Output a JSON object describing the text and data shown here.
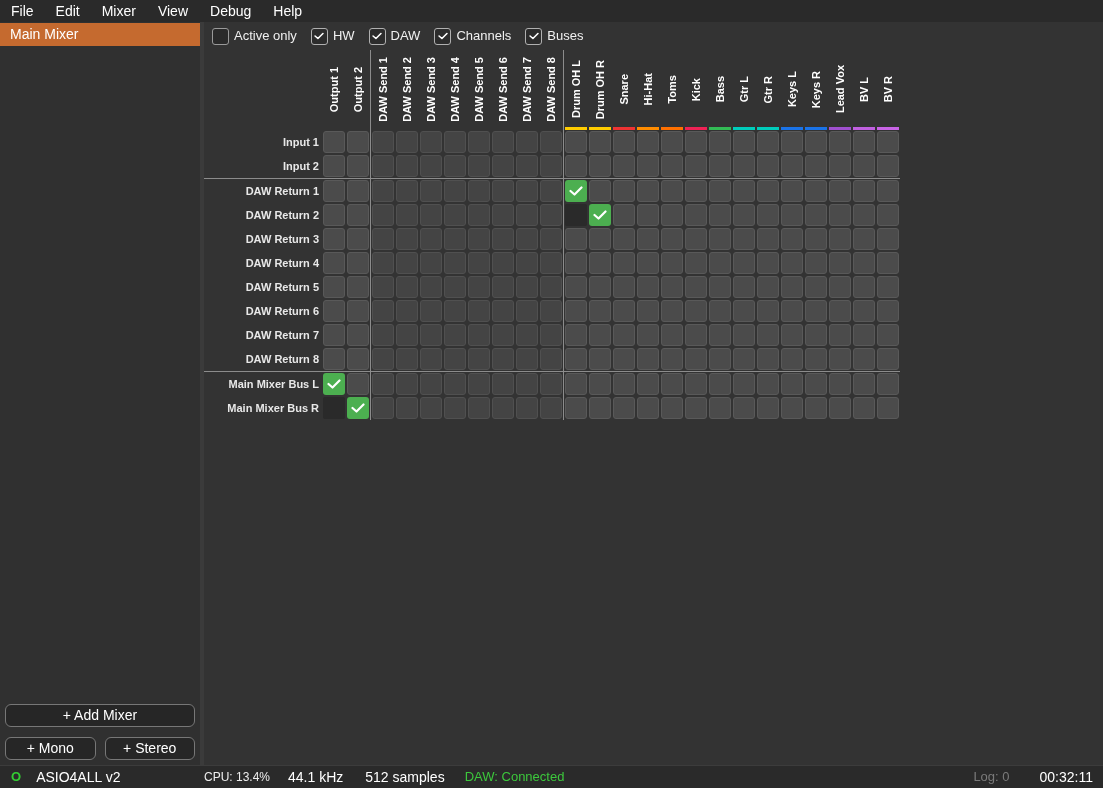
{
  "menu": [
    "File",
    "Edit",
    "Mixer",
    "View",
    "Debug",
    "Help"
  ],
  "sidebar": {
    "mixers": [
      {
        "label": "Main Mixer",
        "selected": true
      }
    ],
    "add_mixer_button": "+ Add Mixer",
    "add_channel_buttons": [
      "+ Mono",
      "+ Stereo"
    ]
  },
  "filters": [
    {
      "label": "Active only",
      "checked": false
    },
    {
      "label": "HW",
      "checked": true
    },
    {
      "label": "DAW",
      "checked": true
    },
    {
      "label": "Channels",
      "checked": true
    },
    {
      "label": "Buses",
      "checked": true
    }
  ],
  "matrix": {
    "column_groups": [
      {
        "kind": "hardware",
        "columns": [
          {
            "label": "Output 1"
          },
          {
            "label": "Output 2"
          }
        ]
      },
      {
        "kind": "daw",
        "columns": [
          {
            "label": "DAW Send 1"
          },
          {
            "label": "DAW Send 2"
          },
          {
            "label": "DAW Send 3"
          },
          {
            "label": "DAW Send 4"
          },
          {
            "label": "DAW Send 5"
          },
          {
            "label": "DAW Send 6"
          },
          {
            "label": "DAW Send 7"
          },
          {
            "label": "DAW Send 8"
          }
        ]
      },
      {
        "kind": "channel",
        "columns": [
          {
            "label": "Drum OH L",
            "color": "#ffcc00"
          },
          {
            "label": "Drum OH R",
            "color": "#ffcc00"
          },
          {
            "label": "Snare",
            "color": "#ee3333"
          },
          {
            "label": "Hi-Hat",
            "color": "#ff8c00"
          },
          {
            "label": "Toms",
            "color": "#ff7000"
          },
          {
            "label": "Kick",
            "color": "#ee2255"
          },
          {
            "label": "Bass",
            "color": "#33bb55"
          },
          {
            "label": "Gtr L",
            "color": "#00ccbb"
          },
          {
            "label": "Gtr R",
            "color": "#00ccbb"
          },
          {
            "label": "Keys L",
            "color": "#1a73e8"
          },
          {
            "label": "Keys R",
            "color": "#1a73e8"
          },
          {
            "label": "Lead Vox",
            "color": "#a050d0"
          },
          {
            "label": "BV L",
            "color": "#c060e0"
          },
          {
            "label": "BV R",
            "color": "#c864e6"
          }
        ]
      }
    ],
    "row_groups": [
      {
        "rows": [
          {
            "label": "Input 1",
            "cells": [
              {
                "checked": false,
                "disabled": false
              },
              {
                "checked": false,
                "disabled": false
              },
              {
                "checked": false,
                "disabled": false
              },
              {
                "checked": false,
                "disabled": false
              },
              {
                "checked": false,
                "disabled": false
              },
              {
                "checked": false,
                "disabled": false
              },
              {
                "checked": false,
                "disabled": false
              },
              {
                "checked": false,
                "disabled": false
              },
              {
                "checked": false,
                "disabled": false
              },
              {
                "checked": false,
                "disabled": false
              },
              {
                "checked": false,
                "disabled": false
              },
              {
                "checked": false,
                "disabled": false
              },
              {
                "checked": false,
                "disabled": false
              },
              {
                "checked": false,
                "disabled": false
              },
              {
                "checked": false,
                "disabled": false
              },
              {
                "checked": false,
                "disabled": false
              },
              {
                "checked": false,
                "disabled": false
              },
              {
                "checked": false,
                "disabled": false
              },
              {
                "checked": false,
                "disabled": false
              },
              {
                "checked": false,
                "disabled": false
              },
              {
                "checked": false,
                "disabled": false
              },
              {
                "checked": false,
                "disabled": false
              },
              {
                "checked": false,
                "disabled": false
              },
              {
                "checked": false,
                "disabled": false
              }
            ]
          },
          {
            "label": "Input 2",
            "cells": [
              {
                "checked": false,
                "disabled": false
              },
              {
                "checked": false,
                "disabled": false
              },
              {
                "checked": false,
                "disabled": false
              },
              {
                "checked": false,
                "disabled": false
              },
              {
                "checked": false,
                "disabled": false
              },
              {
                "checked": false,
                "disabled": false
              },
              {
                "checked": false,
                "disabled": false
              },
              {
                "checked": false,
                "disabled": false
              },
              {
                "checked": false,
                "disabled": false
              },
              {
                "checked": false,
                "disabled": false
              },
              {
                "checked": false,
                "disabled": false
              },
              {
                "checked": false,
                "disabled": false
              },
              {
                "checked": false,
                "disabled": false
              },
              {
                "checked": false,
                "disabled": false
              },
              {
                "checked": false,
                "disabled": false
              },
              {
                "checked": false,
                "disabled": false
              },
              {
                "checked": false,
                "disabled": false
              },
              {
                "checked": false,
                "disabled": false
              },
              {
                "checked": false,
                "disabled": false
              },
              {
                "checked": false,
                "disabled": false
              },
              {
                "checked": false,
                "disabled": false
              },
              {
                "checked": false,
                "disabled": false
              },
              {
                "checked": false,
                "disabled": false
              },
              {
                "checked": false,
                "disabled": false
              }
            ]
          }
        ]
      },
      {
        "rows": [
          {
            "label": "DAW Return 1",
            "cells": [
              {
                "checked": false,
                "disabled": false
              },
              {
                "checked": false,
                "disabled": false
              },
              {
                "checked": false,
                "disabled": false
              },
              {
                "checked": false,
                "disabled": false
              },
              {
                "checked": false,
                "disabled": false
              },
              {
                "checked": false,
                "disabled": false
              },
              {
                "checked": false,
                "disabled": false
              },
              {
                "checked": false,
                "disabled": false
              },
              {
                "checked": false,
                "disabled": false
              },
              {
                "checked": false,
                "disabled": false
              },
              {
                "checked": true,
                "disabled": false
              },
              {
                "checked": false,
                "disabled": false
              },
              {
                "checked": false,
                "disabled": false
              },
              {
                "checked": false,
                "disabled": false
              },
              {
                "checked": false,
                "disabled": false
              },
              {
                "checked": false,
                "disabled": false
              },
              {
                "checked": false,
                "disabled": false
              },
              {
                "checked": false,
                "disabled": false
              },
              {
                "checked": false,
                "disabled": false
              },
              {
                "checked": false,
                "disabled": false
              },
              {
                "checked": false,
                "disabled": false
              },
              {
                "checked": false,
                "disabled": false
              },
              {
                "checked": false,
                "disabled": false
              },
              {
                "checked": false,
                "disabled": false
              }
            ]
          },
          {
            "label": "DAW Return 2",
            "cells": [
              {
                "checked": false,
                "disabled": false
              },
              {
                "checked": false,
                "disabled": false
              },
              {
                "checked": false,
                "disabled": false
              },
              {
                "checked": false,
                "disabled": false
              },
              {
                "checked": false,
                "disabled": false
              },
              {
                "checked": false,
                "disabled": false
              },
              {
                "checked": false,
                "disabled": false
              },
              {
                "checked": false,
                "disabled": false
              },
              {
                "checked": false,
                "disabled": false
              },
              {
                "checked": false,
                "disabled": false
              },
              {
                "checked": false,
                "disabled": true
              },
              {
                "checked": true,
                "disabled": false
              },
              {
                "checked": false,
                "disabled": false
              },
              {
                "checked": false,
                "disabled": false
              },
              {
                "checked": false,
                "disabled": false
              },
              {
                "checked": false,
                "disabled": false
              },
              {
                "checked": false,
                "disabled": false
              },
              {
                "checked": false,
                "disabled": false
              },
              {
                "checked": false,
                "disabled": false
              },
              {
                "checked": false,
                "disabled": false
              },
              {
                "checked": false,
                "disabled": false
              },
              {
                "checked": false,
                "disabled": false
              },
              {
                "checked": false,
                "disabled": false
              },
              {
                "checked": false,
                "disabled": false
              }
            ]
          },
          {
            "label": "DAW Return 3",
            "cells": [
              {
                "checked": false,
                "disabled": false
              },
              {
                "checked": false,
                "disabled": false
              },
              {
                "checked": false,
                "disabled": false
              },
              {
                "checked": false,
                "disabled": false
              },
              {
                "checked": false,
                "disabled": false
              },
              {
                "checked": false,
                "disabled": false
              },
              {
                "checked": false,
                "disabled": false
              },
              {
                "checked": false,
                "disabled": false
              },
              {
                "checked": false,
                "disabled": false
              },
              {
                "checked": false,
                "disabled": false
              },
              {
                "checked": false,
                "disabled": false
              },
              {
                "checked": false,
                "disabled": false
              },
              {
                "checked": false,
                "disabled": false
              },
              {
                "checked": false,
                "disabled": false
              },
              {
                "checked": false,
                "disabled": false
              },
              {
                "checked": false,
                "disabled": false
              },
              {
                "checked": false,
                "disabled": false
              },
              {
                "checked": false,
                "disabled": false
              },
              {
                "checked": false,
                "disabled": false
              },
              {
                "checked": false,
                "disabled": false
              },
              {
                "checked": false,
                "disabled": false
              },
              {
                "checked": false,
                "disabled": false
              },
              {
                "checked": false,
                "disabled": false
              },
              {
                "checked": false,
                "disabled": false
              }
            ]
          },
          {
            "label": "DAW Return 4",
            "cells": [
              {
                "checked": false,
                "disabled": false
              },
              {
                "checked": false,
                "disabled": false
              },
              {
                "checked": false,
                "disabled": false
              },
              {
                "checked": false,
                "disabled": false
              },
              {
                "checked": false,
                "disabled": false
              },
              {
                "checked": false,
                "disabled": false
              },
              {
                "checked": false,
                "disabled": false
              },
              {
                "checked": false,
                "disabled": false
              },
              {
                "checked": false,
                "disabled": false
              },
              {
                "checked": false,
                "disabled": false
              },
              {
                "checked": false,
                "disabled": false
              },
              {
                "checked": false,
                "disabled": false
              },
              {
                "checked": false,
                "disabled": false
              },
              {
                "checked": false,
                "disabled": false
              },
              {
                "checked": false,
                "disabled": false
              },
              {
                "checked": false,
                "disabled": false
              },
              {
                "checked": false,
                "disabled": false
              },
              {
                "checked": false,
                "disabled": false
              },
              {
                "checked": false,
                "disabled": false
              },
              {
                "checked": false,
                "disabled": false
              },
              {
                "checked": false,
                "disabled": false
              },
              {
                "checked": false,
                "disabled": false
              },
              {
                "checked": false,
                "disabled": false
              },
              {
                "checked": false,
                "disabled": false
              }
            ]
          },
          {
            "label": "DAW Return 5",
            "cells": [
              {
                "checked": false,
                "disabled": false
              },
              {
                "checked": false,
                "disabled": false
              },
              {
                "checked": false,
                "disabled": false
              },
              {
                "checked": false,
                "disabled": false
              },
              {
                "checked": false,
                "disabled": false
              },
              {
                "checked": false,
                "disabled": false
              },
              {
                "checked": false,
                "disabled": false
              },
              {
                "checked": false,
                "disabled": false
              },
              {
                "checked": false,
                "disabled": false
              },
              {
                "checked": false,
                "disabled": false
              },
              {
                "checked": false,
                "disabled": false
              },
              {
                "checked": false,
                "disabled": false
              },
              {
                "checked": false,
                "disabled": false
              },
              {
                "checked": false,
                "disabled": false
              },
              {
                "checked": false,
                "disabled": false
              },
              {
                "checked": false,
                "disabled": false
              },
              {
                "checked": false,
                "disabled": false
              },
              {
                "checked": false,
                "disabled": false
              },
              {
                "checked": false,
                "disabled": false
              },
              {
                "checked": false,
                "disabled": false
              },
              {
                "checked": false,
                "disabled": false
              },
              {
                "checked": false,
                "disabled": false
              },
              {
                "checked": false,
                "disabled": false
              },
              {
                "checked": false,
                "disabled": false
              }
            ]
          },
          {
            "label": "DAW Return 6",
            "cells": [
              {
                "checked": false,
                "disabled": false
              },
              {
                "checked": false,
                "disabled": false
              },
              {
                "checked": false,
                "disabled": false
              },
              {
                "checked": false,
                "disabled": false
              },
              {
                "checked": false,
                "disabled": false
              },
              {
                "checked": false,
                "disabled": false
              },
              {
                "checked": false,
                "disabled": false
              },
              {
                "checked": false,
                "disabled": false
              },
              {
                "checked": false,
                "disabled": false
              },
              {
                "checked": false,
                "disabled": false
              },
              {
                "checked": false,
                "disabled": false
              },
              {
                "checked": false,
                "disabled": false
              },
              {
                "checked": false,
                "disabled": false
              },
              {
                "checked": false,
                "disabled": false
              },
              {
                "checked": false,
                "disabled": false
              },
              {
                "checked": false,
                "disabled": false
              },
              {
                "checked": false,
                "disabled": false
              },
              {
                "checked": false,
                "disabled": false
              },
              {
                "checked": false,
                "disabled": false
              },
              {
                "checked": false,
                "disabled": false
              },
              {
                "checked": false,
                "disabled": false
              },
              {
                "checked": false,
                "disabled": false
              },
              {
                "checked": false,
                "disabled": false
              },
              {
                "checked": false,
                "disabled": false
              }
            ]
          },
          {
            "label": "DAW Return 7",
            "cells": [
              {
                "checked": false,
                "disabled": false
              },
              {
                "checked": false,
                "disabled": false
              },
              {
                "checked": false,
                "disabled": false
              },
              {
                "checked": false,
                "disabled": false
              },
              {
                "checked": false,
                "disabled": false
              },
              {
                "checked": false,
                "disabled": false
              },
              {
                "checked": false,
                "disabled": false
              },
              {
                "checked": false,
                "disabled": false
              },
              {
                "checked": false,
                "disabled": false
              },
              {
                "checked": false,
                "disabled": false
              },
              {
                "checked": false,
                "disabled": false
              },
              {
                "checked": false,
                "disabled": false
              },
              {
                "checked": false,
                "disabled": false
              },
              {
                "checked": false,
                "disabled": false
              },
              {
                "checked": false,
                "disabled": false
              },
              {
                "checked": false,
                "disabled": false
              },
              {
                "checked": false,
                "disabled": false
              },
              {
                "checked": false,
                "disabled": false
              },
              {
                "checked": false,
                "disabled": false
              },
              {
                "checked": false,
                "disabled": false
              },
              {
                "checked": false,
                "disabled": false
              },
              {
                "checked": false,
                "disabled": false
              },
              {
                "checked": false,
                "disabled": false
              },
              {
                "checked": false,
                "disabled": false
              }
            ]
          },
          {
            "label": "DAW Return 8",
            "cells": [
              {
                "checked": false,
                "disabled": false
              },
              {
                "checked": false,
                "disabled": false
              },
              {
                "checked": false,
                "disabled": false
              },
              {
                "checked": false,
                "disabled": false
              },
              {
                "checked": false,
                "disabled": false
              },
              {
                "checked": false,
                "disabled": false
              },
              {
                "checked": false,
                "disabled": false
              },
              {
                "checked": false,
                "disabled": false
              },
              {
                "checked": false,
                "disabled": false
              },
              {
                "checked": false,
                "disabled": false
              },
              {
                "checked": false,
                "disabled": false
              },
              {
                "checked": false,
                "disabled": false
              },
              {
                "checked": false,
                "disabled": false
              },
              {
                "checked": false,
                "disabled": false
              },
              {
                "checked": false,
                "disabled": false
              },
              {
                "checked": false,
                "disabled": false
              },
              {
                "checked": false,
                "disabled": false
              },
              {
                "checked": false,
                "disabled": false
              },
              {
                "checked": false,
                "disabled": false
              },
              {
                "checked": false,
                "disabled": false
              },
              {
                "checked": false,
                "disabled": false
              },
              {
                "checked": false,
                "disabled": false
              },
              {
                "checked": false,
                "disabled": false
              },
              {
                "checked": false,
                "disabled": false
              }
            ]
          }
        ]
      },
      {
        "rows": [
          {
            "label": "Main Mixer Bus L",
            "cells": [
              {
                "checked": true,
                "disabled": false
              },
              {
                "checked": false,
                "disabled": false
              },
              {
                "checked": false,
                "disabled": false
              },
              {
                "checked": false,
                "disabled": false
              },
              {
                "checked": false,
                "disabled": false
              },
              {
                "checked": false,
                "disabled": false
              },
              {
                "checked": false,
                "disabled": false
              },
              {
                "checked": false,
                "disabled": false
              },
              {
                "checked": false,
                "disabled": false
              },
              {
                "checked": false,
                "disabled": false
              },
              {
                "checked": false,
                "disabled": false
              },
              {
                "checked": false,
                "disabled": false
              },
              {
                "checked": false,
                "disabled": false
              },
              {
                "checked": false,
                "disabled": false
              },
              {
                "checked": false,
                "disabled": false
              },
              {
                "checked": false,
                "disabled": false
              },
              {
                "checked": false,
                "disabled": false
              },
              {
                "checked": false,
                "disabled": false
              },
              {
                "checked": false,
                "disabled": false
              },
              {
                "checked": false,
                "disabled": false
              },
              {
                "checked": false,
                "disabled": false
              },
              {
                "checked": false,
                "disabled": false
              },
              {
                "checked": false,
                "disabled": false
              },
              {
                "checked": false,
                "disabled": false
              }
            ]
          },
          {
            "label": "Main Mixer Bus R",
            "cells": [
              {
                "checked": false,
                "disabled": true
              },
              {
                "checked": true,
                "disabled": false
              },
              {
                "checked": false,
                "disabled": false
              },
              {
                "checked": false,
                "disabled": false
              },
              {
                "checked": false,
                "disabled": false
              },
              {
                "checked": false,
                "disabled": false
              },
              {
                "checked": false,
                "disabled": false
              },
              {
                "checked": false,
                "disabled": false
              },
              {
                "checked": false,
                "disabled": false
              },
              {
                "checked": false,
                "disabled": false
              },
              {
                "checked": false,
                "disabled": false
              },
              {
                "checked": false,
                "disabled": false
              },
              {
                "checked": false,
                "disabled": false
              },
              {
                "checked": false,
                "disabled": false
              },
              {
                "checked": false,
                "disabled": false
              },
              {
                "checked": false,
                "disabled": false
              },
              {
                "checked": false,
                "disabled": false
              },
              {
                "checked": false,
                "disabled": false
              },
              {
                "checked": false,
                "disabled": false
              },
              {
                "checked": false,
                "disabled": false
              },
              {
                "checked": false,
                "disabled": false
              },
              {
                "checked": false,
                "disabled": false
              },
              {
                "checked": false,
                "disabled": false
              },
              {
                "checked": false,
                "disabled": false
              }
            ]
          }
        ]
      }
    ]
  },
  "status_bar": {
    "driver": {
      "indicator": "O",
      "name": "ASIO4ALL v2",
      "running": true
    },
    "cpu": "CPU: 13.4%",
    "sample_rate": "44.1 kHz",
    "buffer": "512 samples",
    "daw": {
      "text": "DAW: Connected",
      "connected": true
    },
    "log": "Log: 0",
    "time": "00:32:11"
  }
}
